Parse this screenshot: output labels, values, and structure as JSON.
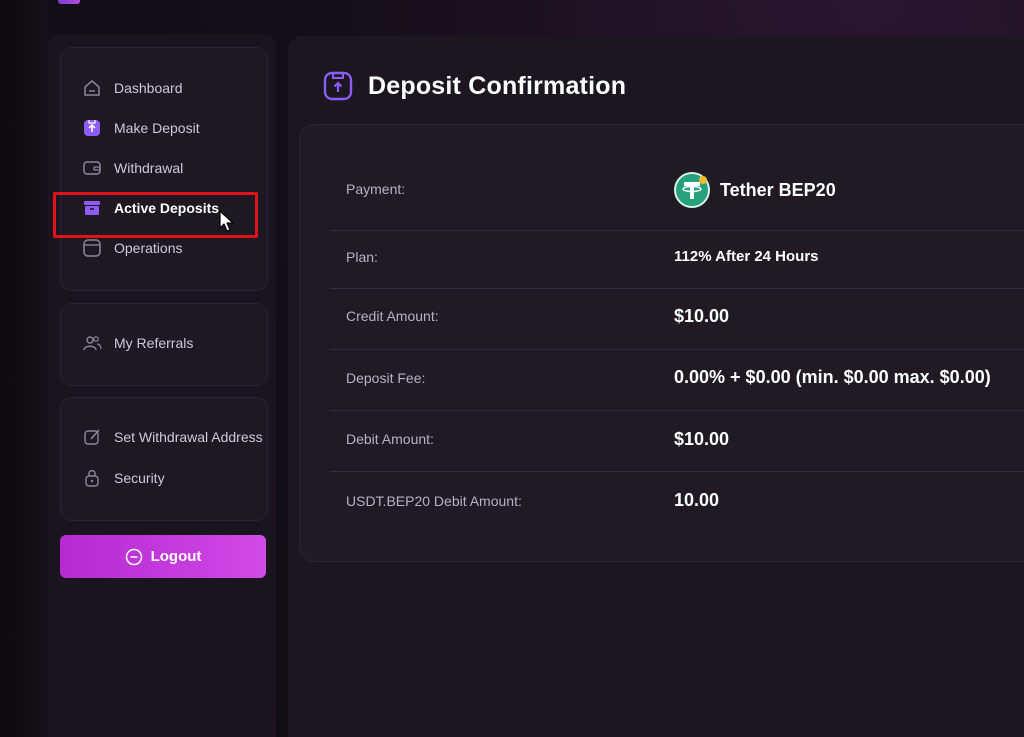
{
  "sidebar": {
    "nav_main": [
      {
        "label": "Dashboard",
        "icon": "home-icon"
      },
      {
        "label": "Make Deposit",
        "icon": "deposit-icon"
      },
      {
        "label": "Withdrawal",
        "icon": "wallet-icon"
      },
      {
        "label": "Active Deposits",
        "icon": "archive-icon"
      },
      {
        "label": "Operations",
        "icon": "operations-icon"
      }
    ],
    "referrals": {
      "label": "My Referrals",
      "icon": "users-icon"
    },
    "settings": [
      {
        "label": "Set Withdrawal Address",
        "icon": "edit-icon"
      },
      {
        "label": "Security",
        "icon": "lock-icon"
      }
    ],
    "logout_label": "Logout"
  },
  "main": {
    "title": "Deposit Confirmation",
    "rows": [
      {
        "label": "Payment:",
        "value": "Tether BEP20"
      },
      {
        "label": "Plan:",
        "value": "112% After 24 Hours"
      },
      {
        "label": "Credit Amount:",
        "value": "$10.00"
      },
      {
        "label": "Deposit Fee:",
        "value": "0.00% + $0.00 (min. $0.00 max. $0.00)"
      },
      {
        "label": "Debit Amount:",
        "value": "$10.00"
      },
      {
        "label": "USDT.BEP20 Debit Amount:",
        "value": "10.00"
      }
    ]
  },
  "colors": {
    "accent": "#8b5cf6",
    "logout": "#c43add",
    "highlight": "#e0131a",
    "tether": "#26a17b"
  }
}
